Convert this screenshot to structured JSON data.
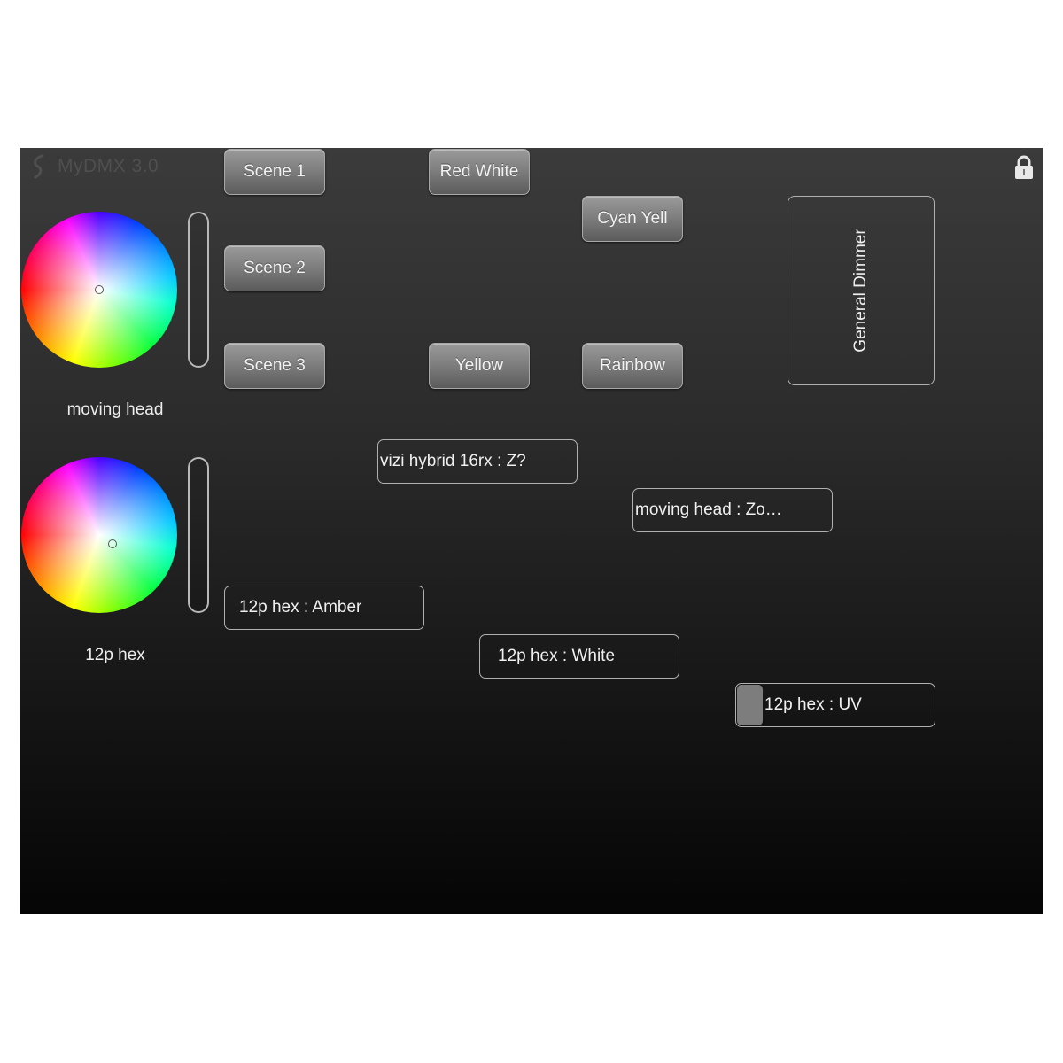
{
  "app": {
    "title": "MyDMX 3.0",
    "logo_icon": "mydmx-logo-icon",
    "lock_icon": "lock-icon"
  },
  "scene_buttons": [
    {
      "label": "Scene 1"
    },
    {
      "label": "Scene 2"
    },
    {
      "label": "Scene 3"
    },
    {
      "label": "Red White"
    },
    {
      "label": "Cyan Yell"
    },
    {
      "label": "Yellow"
    },
    {
      "label": "Rainbow"
    }
  ],
  "color_wheels": [
    {
      "fixture": "moving head"
    },
    {
      "fixture": "12p hex"
    }
  ],
  "general_dimmer": {
    "label": "General Dimmer"
  },
  "faders": [
    {
      "label": "vizi hybrid 16rx : Z?",
      "value": 0
    },
    {
      "label": "moving head : Zo…",
      "value": 0
    },
    {
      "label": "12p hex : Amber",
      "value": 0
    },
    {
      "label": "12p hex : White",
      "value": 0
    },
    {
      "label": "12p hex : UV",
      "value": 0.05
    }
  ],
  "colors": {
    "background_top": "#3b3b3b",
    "background_bottom": "#050505",
    "button": "#7c7c7c",
    "border": "#b0b0b0"
  }
}
